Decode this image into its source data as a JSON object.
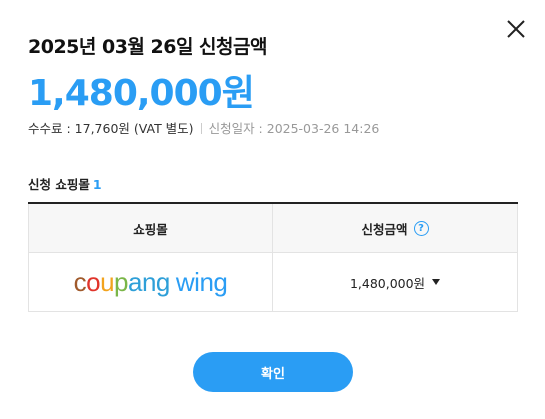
{
  "dialog": {
    "title": "2025년 03월 26일 신청금액",
    "amount": "1,480,000원",
    "fee": "수수료 : 17,760원 (VAT 별도)",
    "apply_date": "신청일자 : 2025-03-26 14:26"
  },
  "section": {
    "label": "신청 쇼핑몰",
    "count": "1"
  },
  "table": {
    "headers": [
      "쇼핑몰",
      "신청금액"
    ],
    "help_icon": "?",
    "rows": [
      {
        "shop_logo": {
          "name": "coupang wing",
          "letters": [
            "c",
            "o",
            "u",
            "p",
            "ang"
          ],
          "suffix": "wing"
        },
        "amount": "1,480,000원"
      }
    ]
  },
  "footer": {
    "confirm_label": "확인"
  },
  "colors": {
    "accent": "#2a9df4",
    "text": "#222222",
    "muted": "#999999",
    "table_header_bg": "#f7f7f7",
    "border": "#e3e3e3"
  },
  "icons": {
    "close": "close-icon",
    "help": "question-circle-icon",
    "dropdown": "caret-down-icon"
  }
}
